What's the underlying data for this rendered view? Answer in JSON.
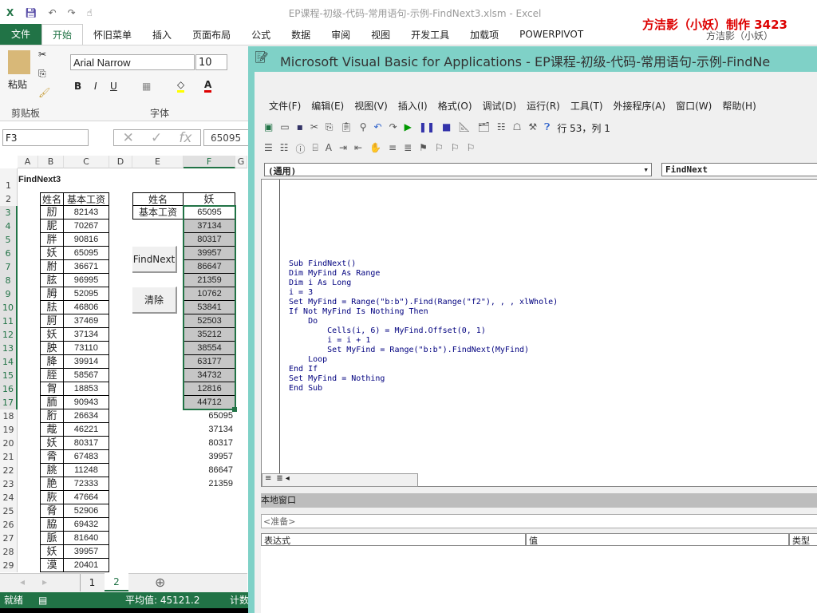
{
  "excel": {
    "title": "EP课程-初级-代码-常用语句-示例-FindNext3.xlsm - Excel",
    "watermark": "方洁影（小妖）制作 3423",
    "user": "方洁影（小妖）",
    "tabs": [
      "文件",
      "开始",
      "怀旧菜单",
      "插入",
      "页面布局",
      "公式",
      "数据",
      "审阅",
      "视图",
      "开发工具",
      "加载项",
      "POWERPIVOT"
    ],
    "ribbon": {
      "paste": "粘贴",
      "clipboard": "剪贴板",
      "font_group": "字体",
      "font": "Arial Narrow",
      "size": "10",
      "bold": "B",
      "italic": "I",
      "underline": "U"
    },
    "name_box": "F3",
    "formula": "65095",
    "columns": [
      "A",
      "B",
      "C",
      "D",
      "E",
      "F",
      "G"
    ],
    "sheet_title": "FindNext3",
    "table_headers": [
      "姓名",
      "基本工资"
    ],
    "lookup": {
      "name_label": "姓名",
      "name_value": "妖",
      "salary_label": "基本工资"
    },
    "rows": [
      [
        "肕",
        "82143"
      ],
      [
        "胒",
        "70267"
      ],
      [
        "胖",
        "90816"
      ],
      [
        "妖",
        "65095"
      ],
      [
        "胕",
        "36671"
      ],
      [
        "胘",
        "96995"
      ],
      [
        "胟",
        "52095"
      ],
      [
        "胠",
        "46806"
      ],
      [
        "胢",
        "37469"
      ],
      [
        "妖",
        "37134"
      ],
      [
        "胦",
        "73110"
      ],
      [
        "胮",
        "39914"
      ],
      [
        "胵",
        "58567"
      ],
      [
        "胷",
        "18853"
      ],
      [
        "胹",
        "90943"
      ],
      [
        "胻",
        "26634"
      ],
      [
        "胾",
        "46221"
      ],
      [
        "妖",
        "80317"
      ],
      [
        "脀",
        "67483"
      ],
      [
        "脁",
        "11248"
      ],
      [
        "脃",
        "72333"
      ],
      [
        "脄",
        "47664"
      ],
      [
        "脅",
        "52906"
      ],
      [
        "脇",
        "69432"
      ],
      [
        "脈",
        "81640"
      ],
      [
        "妖",
        "39957"
      ],
      [
        "漠",
        "20401"
      ]
    ],
    "f_values": [
      "65095",
      "37134",
      "80317",
      "39957",
      "86647",
      "21359",
      "10762",
      "53841",
      "52503",
      "35212",
      "38554",
      "63177",
      "34732",
      "12816",
      "44712",
      "65095",
      "37134",
      "80317",
      "39957",
      "86647",
      "21359"
    ],
    "buttons": {
      "findnext": "FindNext",
      "clear": "清除"
    },
    "sheets": [
      "1",
      "2"
    ],
    "status": {
      "ready": "就绪",
      "average": "平均值: 45121.2",
      "count": "计数"
    }
  },
  "vba": {
    "title": "Microsoft Visual Basic for Applications - EP课程-初级-代码-常用语句-示例-FindNe",
    "menu": [
      "文件(F)",
      "编辑(E)",
      "视图(V)",
      "插入(I)",
      "格式(O)",
      "调试(D)",
      "运行(R)",
      "工具(T)",
      "外接程序(A)",
      "窗口(W)",
      "帮助(H)"
    ],
    "position": "行 53，列 1",
    "object_dropdown": "(通用)",
    "proc_dropdown": "FindNext",
    "code": [
      "Sub FindNext()",
      "Dim MyFind As Range",
      "Dim i As Long",
      "i = 3",
      "Set MyFind = Range(\"b:b\").Find(Range(\"f2\"), , , xlWhole)",
      "If Not MyFind Is Nothing Then",
      "    Do",
      "        Cells(i, 6) = MyFind.Offset(0, 1)",
      "        i = i + 1",
      "        Set MyFind = Range(\"b:b\").FindNext(MyFind)",
      "    Loop",
      "End If",
      "Set MyFind = Nothing",
      "End Sub"
    ],
    "locals_title": "本地窗口",
    "locals_state": "<准备>",
    "locals_cols": [
      "表达式",
      "值",
      "类型"
    ]
  },
  "colors": {
    "excel_green": "#217346",
    "vba_frame": "#7fd1c7",
    "code_text": "#00007f",
    "selection": "#c6c6c6"
  }
}
